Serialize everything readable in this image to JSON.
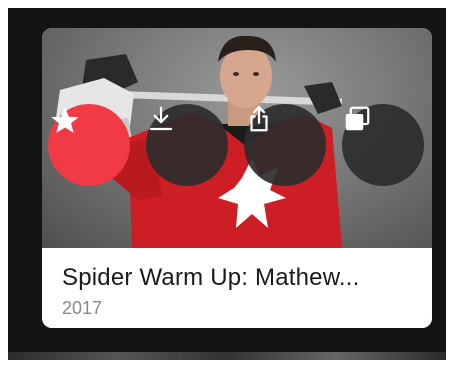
{
  "card": {
    "title": "Spider Warm Up: Mathew...",
    "year": "2017"
  },
  "actions": [
    {
      "name": "favorite",
      "icon": "star-icon",
      "color": "#f23a44"
    },
    {
      "name": "download",
      "icon": "download-icon",
      "color": "#2d2d2d"
    },
    {
      "name": "share",
      "icon": "share-icon",
      "color": "#2d2d2d"
    },
    {
      "name": "picture-in-picture",
      "icon": "pip-icon",
      "color": "#2d2d2d"
    }
  ]
}
